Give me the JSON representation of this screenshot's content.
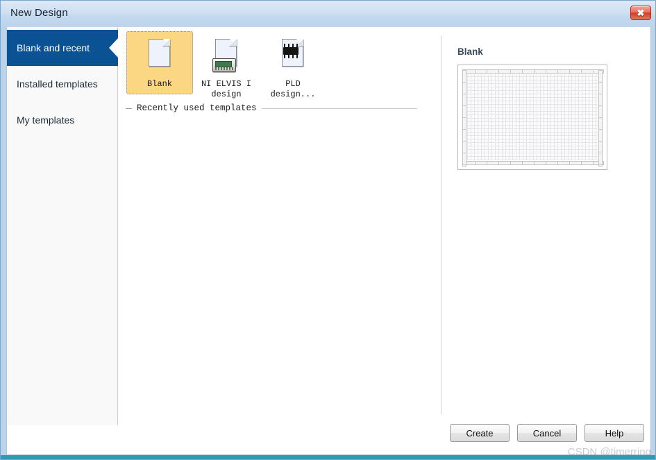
{
  "window": {
    "title": "New Design",
    "close_icon": "close-x-icon",
    "close_glyph": "✖"
  },
  "sidebar": {
    "items": [
      {
        "label": "Blank and recent",
        "selected": true
      },
      {
        "label": "Installed templates",
        "selected": false
      },
      {
        "label": "My templates",
        "selected": false
      }
    ]
  },
  "content": {
    "tiles": [
      {
        "label": "Blank",
        "icon": "blank-document-icon",
        "selected": true
      },
      {
        "label": "NI ELVIS I\ndesign",
        "icon": "ni-elvis-document-icon",
        "selected": false
      },
      {
        "label": "PLD\ndesign...",
        "icon": "pld-document-icon",
        "selected": false
      }
    ],
    "recent_section_label": "Recently used templates"
  },
  "preview": {
    "title": "Blank",
    "thumbnail_name": "blank-grid-sheet-preview"
  },
  "footer": {
    "create_label": "Create",
    "cancel_label": "Cancel",
    "help_label": "Help"
  },
  "watermark": {
    "text": "CSDN @timerring"
  },
  "colors": {
    "titlebar": "#cfe0f2",
    "sidebar_selected": "#0a5294",
    "tile_selected": "#fbd683",
    "close_button": "#cf3e27",
    "preview_title": "#3b4a5c",
    "bottom_accent": "#2f9bb0"
  }
}
